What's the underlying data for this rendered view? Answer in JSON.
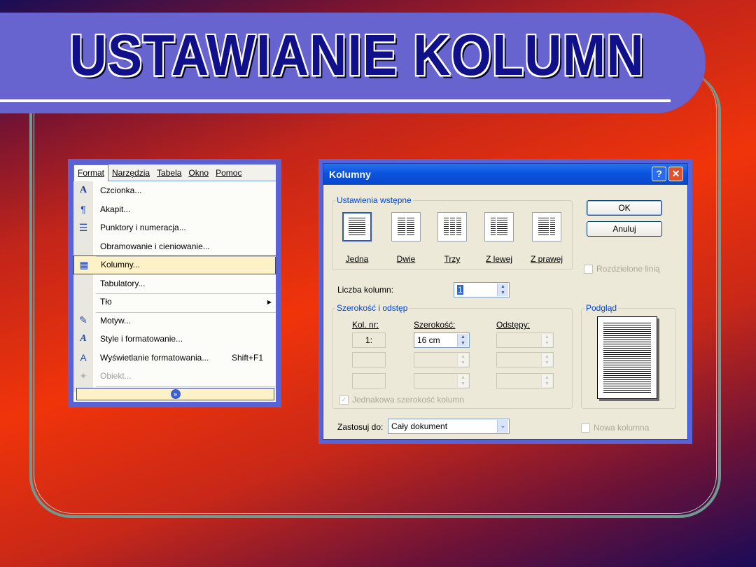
{
  "slide": {
    "title": "USTAWIANIE KOLUMN"
  },
  "menu": {
    "bar": [
      "Format",
      "Narzędzia",
      "Tabela",
      "Okno",
      "Pomoc"
    ],
    "items": [
      {
        "icon": "font-icon",
        "label": "Czcionka...",
        "shortcut": ""
      },
      {
        "icon": "paragraph-icon",
        "label": "Akapit...",
        "shortcut": ""
      },
      {
        "icon": "bullets-icon",
        "label": "Punktory i numeracja...",
        "shortcut": ""
      },
      {
        "icon": "",
        "label": "Obramowanie i cieniowanie...",
        "shortcut": ""
      },
      {
        "icon": "columns-icon",
        "label": "Kolumny...",
        "shortcut": ""
      },
      {
        "icon": "",
        "label": "Tabulatory...",
        "shortcut": ""
      },
      {
        "icon": "",
        "label": "Tło",
        "shortcut": ""
      },
      {
        "icon": "theme-icon",
        "label": "Motyw...",
        "shortcut": ""
      },
      {
        "icon": "styles-icon",
        "label": "Style i formatowanie...",
        "shortcut": ""
      },
      {
        "icon": "reveal-formatting-icon",
        "label": "Wyświetlanie formatowania...",
        "shortcut": "Shift+F1"
      },
      {
        "icon": "object-icon",
        "label": "Obiekt...",
        "shortcut": ""
      }
    ]
  },
  "dialog": {
    "title": "Kolumny",
    "presets_group": "Ustawienia wstępne",
    "presets": [
      "Jedna",
      "Dwie",
      "Trzy",
      "Z lewej",
      "Z prawej"
    ],
    "ok": "OK",
    "cancel": "Anuluj",
    "line_between": "Rozdzielone linią",
    "num_columns_label": "Liczba kolumn:",
    "num_columns_value": "1",
    "width_group": "Szerokość i odstęp",
    "col_header": "Kol. nr:",
    "width_header": "Szerokość:",
    "spacing_header": "Odstępy:",
    "row1_col": "1:",
    "row1_width": "16 cm",
    "equal_width": "Jednakowa szerokość kolumn",
    "preview_group": "Podgląd",
    "apply_label": "Zastosuj do:",
    "apply_value": "Cały dokument",
    "new_column": "Nowa kolumna"
  }
}
